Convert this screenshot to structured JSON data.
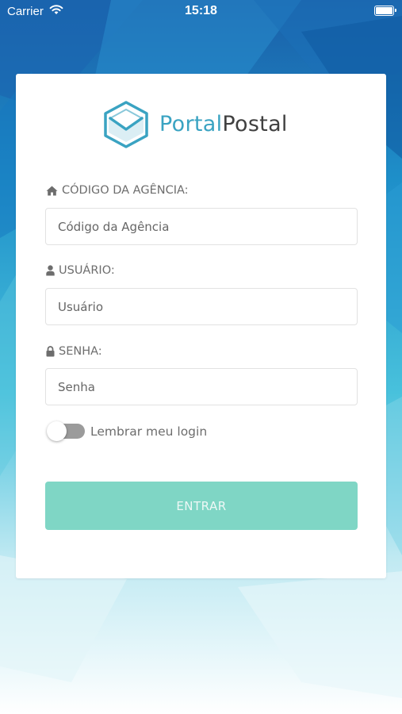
{
  "status_bar": {
    "carrier": "Carrier",
    "time": "15:18"
  },
  "logo": {
    "part1": "Portal",
    "part2": "Postal",
    "icon": "envelope-hexagon-icon"
  },
  "form": {
    "agency": {
      "label": "CÓDIGO DA AGÊNCIA:",
      "placeholder": "Código da Agência",
      "icon": "home-icon"
    },
    "user": {
      "label": "USUÁRIO:",
      "placeholder": "Usuário",
      "icon": "user-icon"
    },
    "password": {
      "label": "SENHA:",
      "placeholder": "Senha",
      "icon": "lock-icon"
    },
    "remember": {
      "label": "Lembrar meu login",
      "on": false
    },
    "submit_label": "ENTRAR"
  },
  "colors": {
    "accent_blue": "#3aa3c2",
    "button": "#7fd6c5",
    "logo_dark": "#404040"
  }
}
